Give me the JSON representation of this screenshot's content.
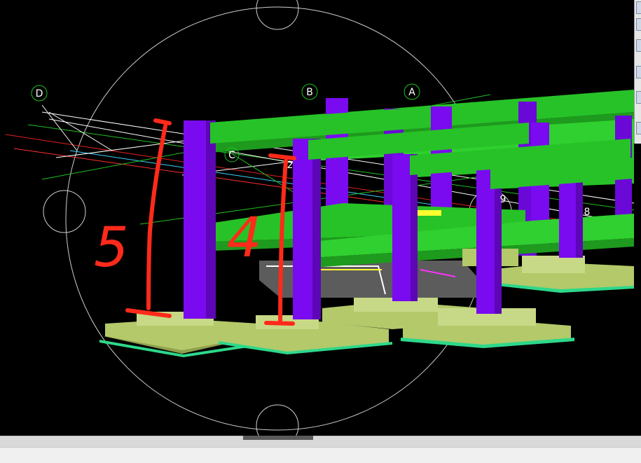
{
  "viewport": {
    "background": "#000000",
    "grid_bubbles": [
      "D",
      "B",
      "A",
      "C"
    ],
    "axis_numbers": [
      "2",
      "9",
      "8"
    ],
    "annotations": [
      {
        "text": "5",
        "color": "#ff2a1a"
      },
      {
        "text": "4",
        "color": "#ff2a1a"
      }
    ],
    "colors": {
      "column": "#7a0af0",
      "slab": "#27c227",
      "footing": "#b3c96a",
      "orbit": "#cfcfcf",
      "markup": "#ff2a1a"
    }
  },
  "toolbar": {
    "icons": [
      "warning-icon",
      "view-cube-icon",
      "pan-icon",
      "home-icon",
      "orbit-icon",
      "showmotion-icon"
    ]
  }
}
